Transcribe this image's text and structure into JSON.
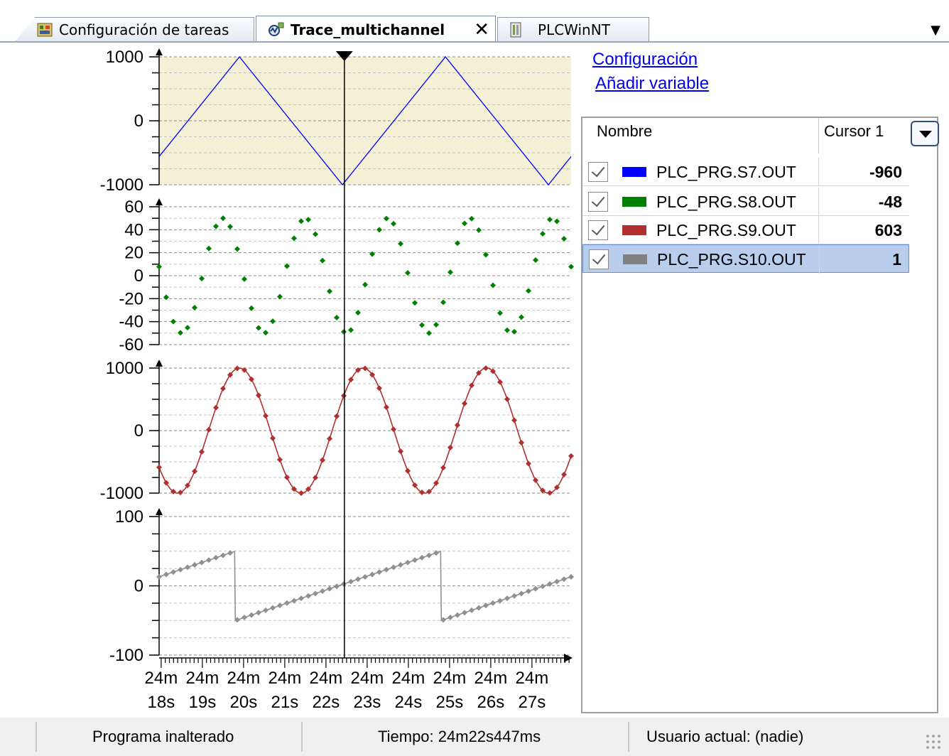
{
  "tabs": [
    {
      "label": "Configuración de tareas",
      "icon": "task-config-icon"
    },
    {
      "label": "Trace_multichannel",
      "icon": "trace-icon",
      "active": true
    },
    {
      "label": "PLCWinNT",
      "icon": "device-icon"
    }
  ],
  "tab_close_glyph": "✕",
  "panel": {
    "config_link": "Configuración",
    "add_var_link": "Añadir variable",
    "col_name": "Nombre",
    "col_cursor": "Cursor 1"
  },
  "variables": [
    {
      "name": "PLC_PRG.S7.OUT",
      "value": "-960",
      "color": "#0000ff",
      "checked": true
    },
    {
      "name": "PLC_PRG.S8.OUT",
      "value": "-48",
      "color": "#008000",
      "checked": true
    },
    {
      "name": "PLC_PRG.S9.OUT",
      "value": "603",
      "color": "#b03030",
      "checked": true
    },
    {
      "name": "PLC_PRG.S10.OUT",
      "value": "1",
      "color": "#808080",
      "checked": true,
      "selected": true
    }
  ],
  "status": {
    "program": "Programa inalterado",
    "time": "Tiempo: 24m22s447ms",
    "user": "Usuario actual: (nadie)"
  },
  "chart_data": {
    "type": "line",
    "cursor_x_label": "24m22s447ms",
    "x_ticks": [
      [
        "24m",
        "18s"
      ],
      [
        "24m",
        "19s"
      ],
      [
        "24m",
        "20s"
      ],
      [
        "24m",
        "21s"
      ],
      [
        "24m",
        "22s"
      ],
      [
        "24m",
        "23s"
      ],
      [
        "24m",
        "24s"
      ],
      [
        "24m",
        "25s"
      ],
      [
        "24m",
        "26s"
      ],
      [
        "24m",
        "27s"
      ]
    ],
    "x_range_s": [
      1457.95,
      1467.95
    ],
    "panels": [
      {
        "series": "PLC_PRG.S7.OUT",
        "color": "#0000ff",
        "style": "line",
        "ylim": [
          -1000,
          1000
        ],
        "y_ticks": [
          "1000",
          "0",
          "-1000"
        ],
        "waveform": "triangle",
        "period_s": 5.0,
        "amplitude": 1000,
        "peaks_at_s": [
          1459.9,
          1464.9
        ],
        "troughs_at_s": [
          1462.4,
          1467.4
        ],
        "shaded": true
      },
      {
        "series": "PLC_PRG.S8.OUT",
        "color": "#008000",
        "style": "points",
        "ylim": [
          -60,
          60
        ],
        "y_ticks": [
          "60",
          "40",
          "20",
          "0",
          "-20",
          "-40",
          "-60"
        ],
        "waveform": "sine",
        "period_s": 2.0,
        "amplitude": 50,
        "peaks_at_s": [
          1459.5,
          1461.5,
          1463.5,
          1465.5,
          1467.5
        ]
      },
      {
        "series": "PLC_PRG.S9.OUT",
        "color": "#b03030",
        "style": "line+points",
        "ylim": [
          -1000,
          1000
        ],
        "y_ticks": [
          "1000",
          "0",
          "-1000"
        ],
        "waveform": "sine",
        "period_s": 3.0,
        "amplitude": 1000,
        "peaks_at_s": [
          1459.9,
          1462.9,
          1465.9
        ]
      },
      {
        "series": "PLC_PRG.S10.OUT",
        "color": "#909090",
        "style": "line+points",
        "ylim": [
          -100,
          100
        ],
        "y_ticks": [
          "100",
          "0",
          "-100"
        ],
        "waveform": "sawtooth",
        "period_s": 5.0,
        "min": -50,
        "max": 50,
        "resets_at_s": [
          1459.8,
          1464.8
        ]
      }
    ]
  }
}
